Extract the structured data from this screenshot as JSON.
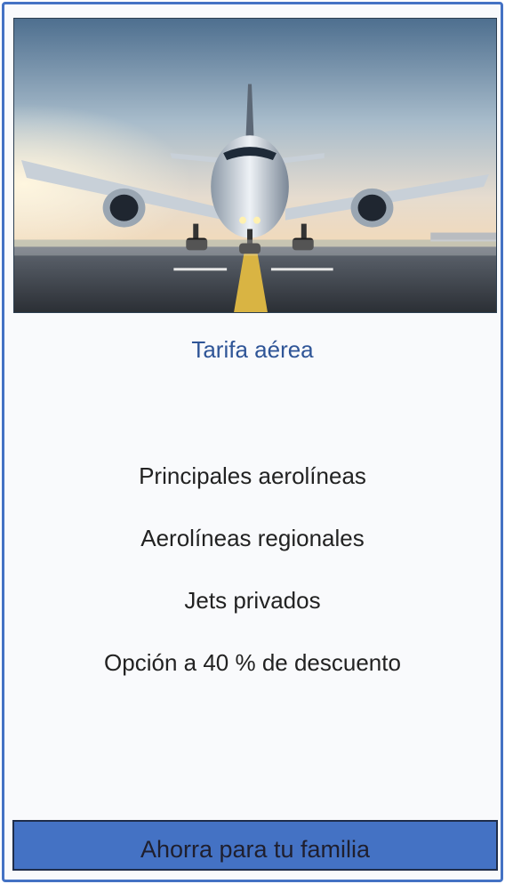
{
  "card": {
    "image_subject": "airplane-on-runway",
    "title": "Tarifa aérea",
    "features": [
      "Principales aerolíneas",
      "Aerolíneas regionales",
      "Jets privados",
      "Opción a 40 % de descuento"
    ],
    "cta_label": "Ahorra para tu familia"
  },
  "colors": {
    "accent": "#4472c4",
    "title": "#2f5597",
    "text": "#222222",
    "background": "#f9fafc"
  }
}
